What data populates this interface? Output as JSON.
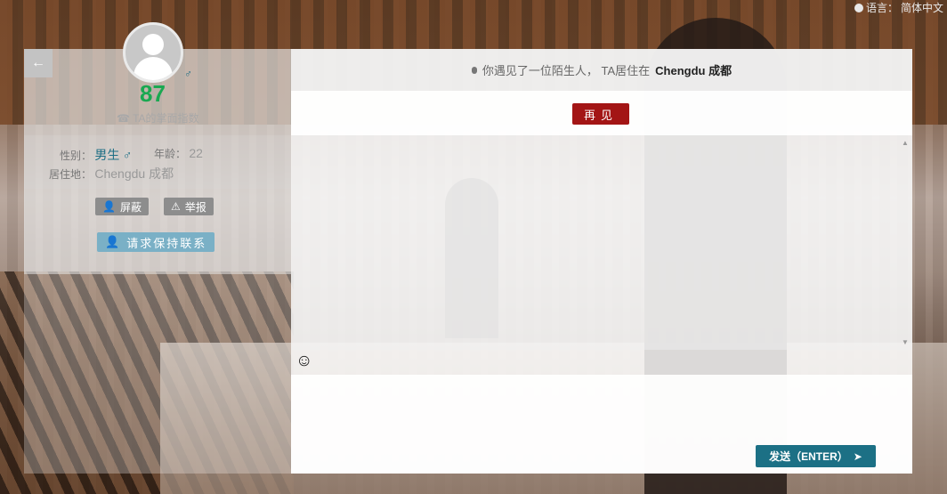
{
  "language": {
    "label": "语言：",
    "value": "简体中文"
  },
  "profile": {
    "score": "87",
    "score_label": "TA的掌面指数",
    "gender_label": "性别：",
    "gender_value": "男生",
    "age_label": "年龄：",
    "age_value": "22",
    "location_label": "居住地：",
    "location_value": "Chengdu 成都",
    "block_label": "屏蔽",
    "report_label": "举报",
    "connect_label": "请求保持联系"
  },
  "chat": {
    "header_prefix": "你遇见了一位陌生人， TA居住在",
    "header_location": "Chengdu 成都",
    "bye_label": "再见",
    "send_label": "发送（ENTER）"
  },
  "colors": {
    "score": "#1aa851",
    "accent": "#1c7085",
    "bye": "#a31515",
    "connect": "#7ab0c6"
  }
}
